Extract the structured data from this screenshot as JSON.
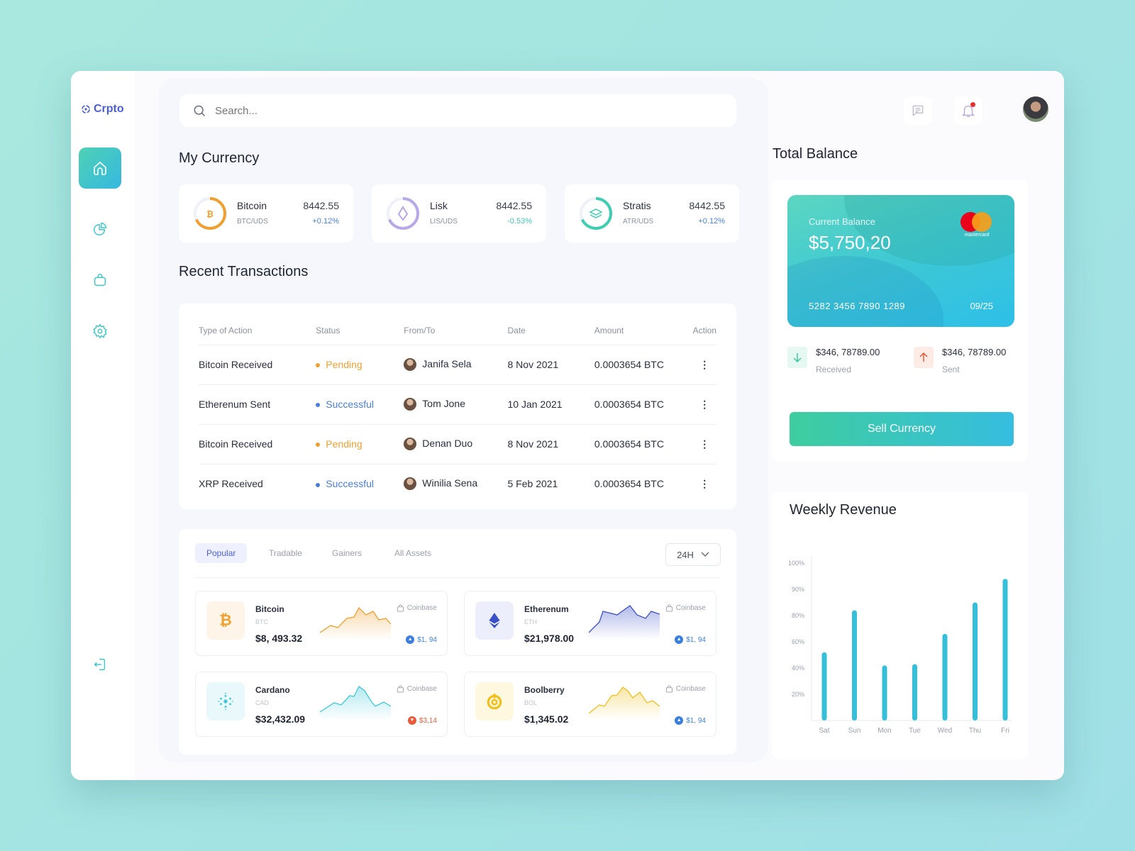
{
  "app": {
    "name": "Crpto"
  },
  "sidebar": {
    "items": [
      {
        "name": "home",
        "icon": "home-icon",
        "active": true
      },
      {
        "name": "portfolio",
        "icon": "pie-chart-icon",
        "active": false
      },
      {
        "name": "shop",
        "icon": "bag-icon",
        "active": false
      },
      {
        "name": "settings",
        "icon": "gear-icon",
        "active": false
      }
    ],
    "logout": "logout-icon"
  },
  "search": {
    "placeholder": "Search..."
  },
  "my_currency": {
    "title": "My Currency",
    "items": [
      {
        "name": "Bitcoin",
        "pair": "BTC/UDS",
        "value": "8442.55",
        "change": "+0.12%",
        "change_color": "#4a7fe0",
        "ring_color": "#f0a030"
      },
      {
        "name": "Lisk",
        "pair": "LIS/UDS",
        "value": "8442.55",
        "change": "-0.53%",
        "change_color": "#3ec8b8",
        "ring_color": "#b9a8e8"
      },
      {
        "name": "Stratis",
        "pair": "ATR/UDS",
        "value": "8442.55",
        "change": "+0.12%",
        "change_color": "#4a7fe0",
        "ring_color": "#3ecdb0"
      }
    ]
  },
  "transactions": {
    "title": "Recent Transactions",
    "columns": [
      "Type of Action",
      "Status",
      "From/To",
      "Date",
      "Amount",
      "Action"
    ],
    "rows": [
      {
        "type": "Bitcoin Received",
        "status": "Pending",
        "status_color": "#f0a030",
        "person": "Janifa Sela",
        "date": "8 Nov 2021",
        "amount": "0.0003654 BTC",
        "action": "⋮"
      },
      {
        "type": "Etherenum Sent",
        "status": "Successful",
        "status_color": "#4a7fe0",
        "person": "Tom Jone",
        "date": "10 Jan 2021",
        "amount": "0.0003654 BTC",
        "action": "⋮"
      },
      {
        "type": "Bitcoin Received",
        "status": "Pending",
        "status_color": "#f0a030",
        "person": "Denan Duo",
        "date": "8 Nov 2021",
        "amount": "0.0003654 BTC",
        "action": "⋮"
      },
      {
        "type": "XRP Received",
        "status": "Successful",
        "status_color": "#4a7fe0",
        "person": "Winilia Sena",
        "date": "5 Feb 2021",
        "amount": "0.0003654 BTC",
        "action": "⋮"
      }
    ]
  },
  "market": {
    "tabs": [
      "Popular",
      "Tradable",
      "Gainers",
      "All Assets"
    ],
    "active_tab": 0,
    "period": "24H",
    "coins": [
      {
        "name": "Bitcoin",
        "symbol": "BTC",
        "price": "$8, 493.32",
        "exchange": "Coinbase",
        "change": "$1, 94",
        "direction": "up",
        "icon": "bitcoin-icon",
        "color": "#f0a030",
        "bg": "#fff4e8"
      },
      {
        "name": "Etherenum",
        "symbol": "ETH",
        "price": "$21,978.00",
        "exchange": "Coinbase",
        "change": "$1, 94",
        "direction": "up",
        "icon": "ethereum-icon",
        "color": "#3a50c8",
        "bg": "#eceffb"
      },
      {
        "name": "Cardano",
        "symbol": "CAD",
        "price": "$32,432.09",
        "exchange": "Coinbase",
        "change": "$3,14",
        "direction": "down",
        "icon": "cardano-icon",
        "color": "#3ec8d8",
        "bg": "#e8f8fb"
      },
      {
        "name": "Boolberry",
        "symbol": "BOL",
        "price": "$1,345.02",
        "exchange": "Coinbase",
        "change": "$1, 94",
        "direction": "up",
        "icon": "boolberry-icon",
        "color": "#f0c020",
        "bg": "#fff8e0"
      }
    ]
  },
  "header": {
    "icons": [
      "chat-icon",
      "bell-icon"
    ],
    "has_notification": true
  },
  "balance": {
    "title": "Total Balance",
    "card": {
      "label": "Current Balance",
      "amount": "$5,750,20",
      "number": "5282 3456 7890 1289",
      "expiry": "09/25",
      "brand": "mastercard"
    },
    "received": {
      "amount": "$346, 78789.00",
      "label": "Received"
    },
    "sent": {
      "amount": "$346, 78789.00",
      "label": "Sent"
    },
    "sell_label": "Sell Currency"
  },
  "chart_data": {
    "type": "bar",
    "title": "Weekly Revenue",
    "categories": [
      "Sat",
      "Sun",
      "Mon",
      "Tue",
      "Wed",
      "Thu",
      "Fri"
    ],
    "values": [
      52,
      82,
      42,
      43,
      66,
      85,
      94
    ],
    "ytick_labels": [
      "20%",
      "40%",
      "60%",
      "80%",
      "90%",
      "100%"
    ],
    "ytick_values": [
      20,
      40,
      60,
      80,
      90,
      100
    ],
    "xlabel": "",
    "ylabel": "",
    "ylim": [
      0,
      100
    ],
    "grid": false,
    "color": "#36bfd8"
  }
}
